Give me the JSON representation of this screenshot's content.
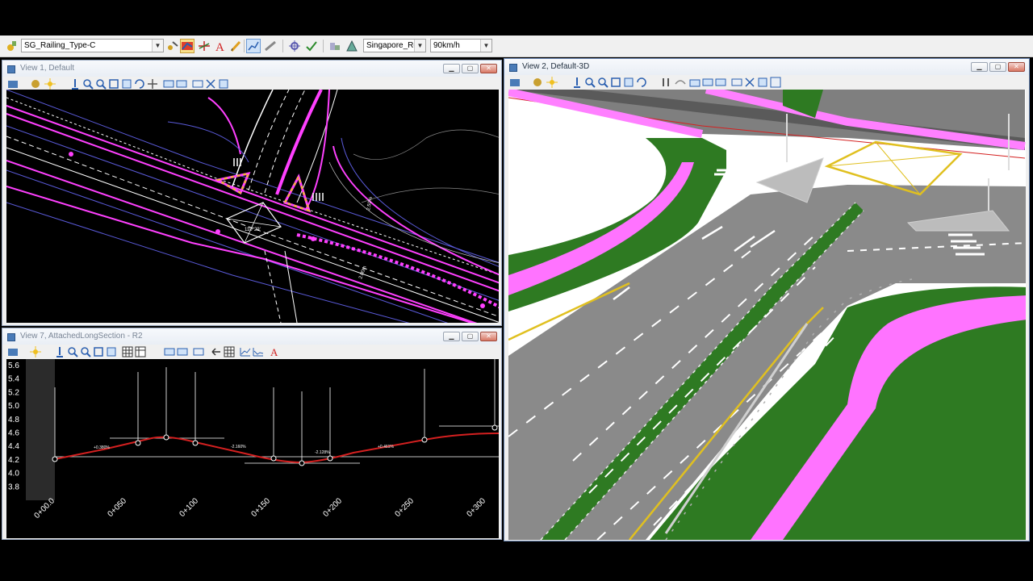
{
  "main_toolbar": {
    "element_template": "SG_Railing_Type-C",
    "design_standard": "Singapore_Road_",
    "design_speed": "90km/h"
  },
  "windows": {
    "view1": {
      "title": "View 1, Default"
    },
    "view7": {
      "title": "View 7, AttachedLongSection - R2"
    },
    "view2": {
      "title": "View 2, Default-3D"
    }
  },
  "profile": {
    "y_ticks": [
      "5.6",
      "5.4",
      "5.2",
      "5.0",
      "4.8",
      "4.6",
      "4.4",
      "4.2",
      "4.0",
      "3.8"
    ],
    "stations": [
      "0+00.0",
      "0+050",
      "0+100",
      "0+150",
      "0+200",
      "0+250",
      "0+300"
    ],
    "grade_labels": [
      "+0.380%",
      "-2.160%",
      "-2.128%",
      "+0.461%"
    ],
    "ylim": [
      3.8,
      5.6
    ]
  },
  "colors": {
    "profile_line": "#d42020",
    "magenta": "#ff40ff",
    "road_grey": "#8a8a8a",
    "grass_green": "#2e7a22",
    "accent_blue": "#4a7bb7"
  }
}
